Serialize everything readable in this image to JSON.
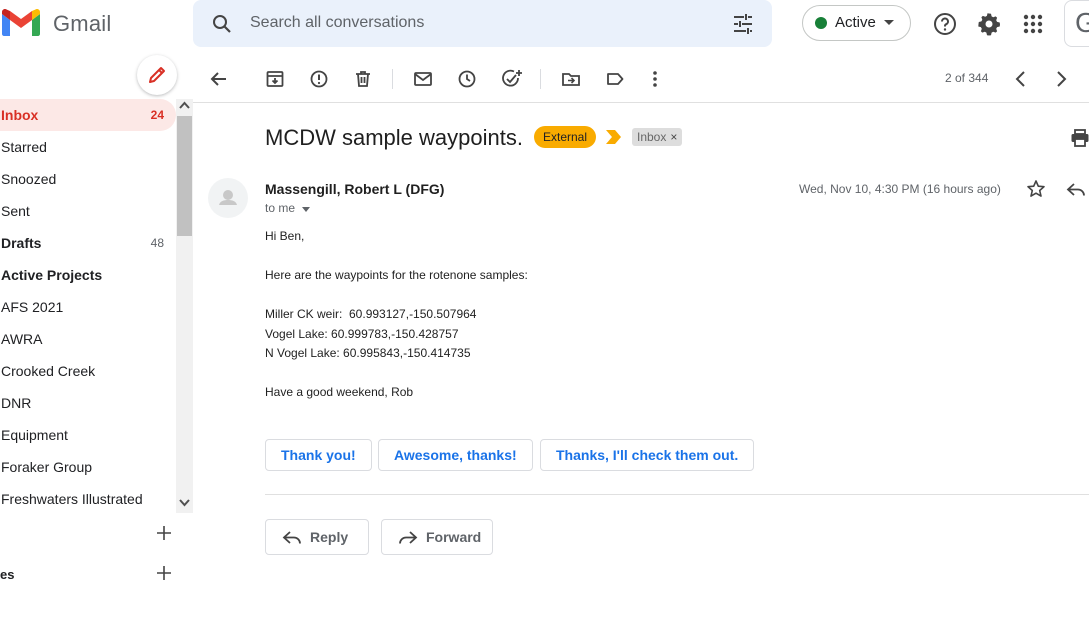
{
  "header": {
    "app_name": "Gmail",
    "search_placeholder": "Search all conversations",
    "status_label": "Active",
    "status_color": "#188038",
    "account_initial": "G",
    "icons": [
      "gmail-logo",
      "search-icon",
      "tune-icon",
      "help-icon",
      "gear-icon",
      "apps-icon"
    ]
  },
  "sidebar": {
    "items": [
      {
        "label": "Inbox",
        "count": "24"
      },
      {
        "label": "Starred",
        "count": ""
      },
      {
        "label": "Snoozed",
        "count": ""
      },
      {
        "label": "Sent",
        "count": ""
      },
      {
        "label": "Drafts",
        "count": "48"
      },
      {
        "label": "Active Projects",
        "count": ""
      },
      {
        "label": "AFS 2021",
        "count": ""
      },
      {
        "label": "AWRA",
        "count": ""
      },
      {
        "label": "Crooked Creek",
        "count": ""
      },
      {
        "label": "DNR",
        "count": ""
      },
      {
        "label": "Equipment",
        "count": ""
      },
      {
        "label": "Foraker Group",
        "count": ""
      },
      {
        "label": "Freshwaters Illustrated",
        "count": ""
      }
    ],
    "section_label": "es",
    "accent_color": "#d93025"
  },
  "toolbar": {
    "pager": "2 of 344",
    "icons": [
      "back-arrow-icon",
      "archive-icon",
      "report-spam-icon",
      "delete-icon",
      "mark-unread-icon",
      "snooze-icon",
      "add-task-icon",
      "move-to-icon",
      "label-icon",
      "more-icon",
      "older-chevron-icon",
      "newer-chevron-icon"
    ]
  },
  "message": {
    "subject": "MCDW sample waypoints.",
    "external_badge": "External",
    "label_chip": "Inbox",
    "label_chip_close": "×",
    "sender": "Massengill, Robert L (DFG)",
    "recipient": "to me",
    "date": "Wed, Nov 10, 4:30 PM (16 hours ago)",
    "body": [
      "Hi Ben,",
      "Here are the waypoints for the rotenone samples:",
      "Miller CK weir:  60.993127,-150.507964",
      "Vogel Lake: 60.999783,-150.428757",
      "N Vogel Lake: 60.995843,-150.414735",
      "Have a good weekend, Rob"
    ],
    "smart_replies": [
      "Thank you!",
      "Awesome, thanks!",
      "Thanks, I'll check them out."
    ],
    "reply_label": "Reply",
    "forward_label": "Forward"
  }
}
